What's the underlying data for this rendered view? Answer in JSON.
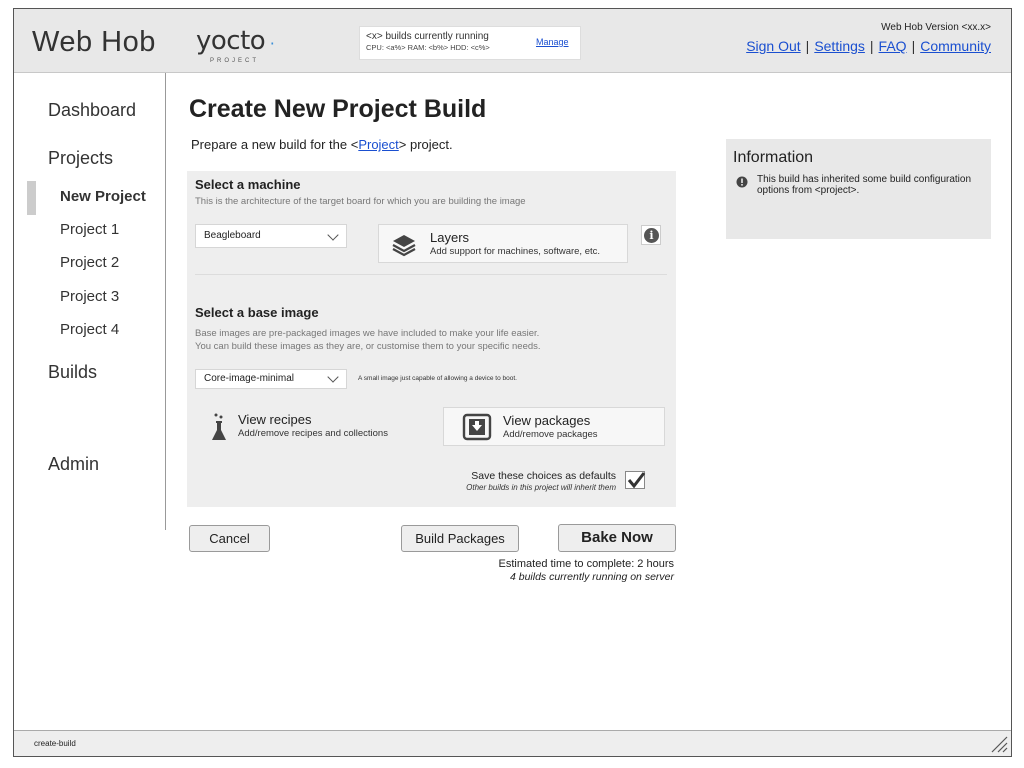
{
  "header": {
    "app_title": "Web Hob",
    "logo": {
      "name": "yocto",
      "subtitle": "PROJECT"
    },
    "status": {
      "running": "<x> builds currently running",
      "resources": "CPU: <a%>   RAM: <b%>   HDD: <c%>",
      "manage_label": "Manage"
    },
    "version": "Web Hob Version <xx.x>",
    "links": [
      "Sign Out",
      "Settings",
      "FAQ",
      "Community"
    ]
  },
  "sidebar": {
    "dashboard": "Dashboard",
    "projects": "Projects",
    "project_items": [
      "New Project",
      "Project 1",
      "Project 2",
      "Project 3",
      "Project 4"
    ],
    "builds": "Builds",
    "admin": "Admin"
  },
  "main": {
    "title": "Create New Project Build",
    "desc_prefix": "Prepare a new build for the <",
    "desc_link": "Project",
    "desc_suffix": "> project.",
    "machine": {
      "title": "Select a machine",
      "help": "This is the architecture of the target board for which you are building the image",
      "selected": "Beagleboard"
    },
    "layers": {
      "title": "Layers",
      "subtitle": "Add support for machines, software, etc."
    },
    "base_image": {
      "title": "Select a base image",
      "help1": "Base images are pre-packaged images we have included to make your life easier.",
      "help2": "You can build these images as they are, or customise them to your specific needs.",
      "selected": "Core-image-minimal",
      "note": "A small image just capable of allowing a device to boot."
    },
    "recipes": {
      "title": "View recipes",
      "subtitle": "Add/remove recipes and collections"
    },
    "packages": {
      "title": "View packages",
      "subtitle": "Add/remove packages"
    },
    "save_defaults": {
      "label": "Save these choices as defaults",
      "sub": "Other builds in this project will inherit them",
      "checked": true
    },
    "buttons": {
      "cancel": "Cancel",
      "build_packages": "Build Packages",
      "bake_now": "Bake Now"
    },
    "estimate": "Estimated time to complete: 2 hours",
    "running_note": "4 builds currently running on server"
  },
  "info": {
    "title": "Information",
    "text": "This build has inherited some build configuration options from <project>."
  },
  "footer": {
    "label": "create-build"
  }
}
